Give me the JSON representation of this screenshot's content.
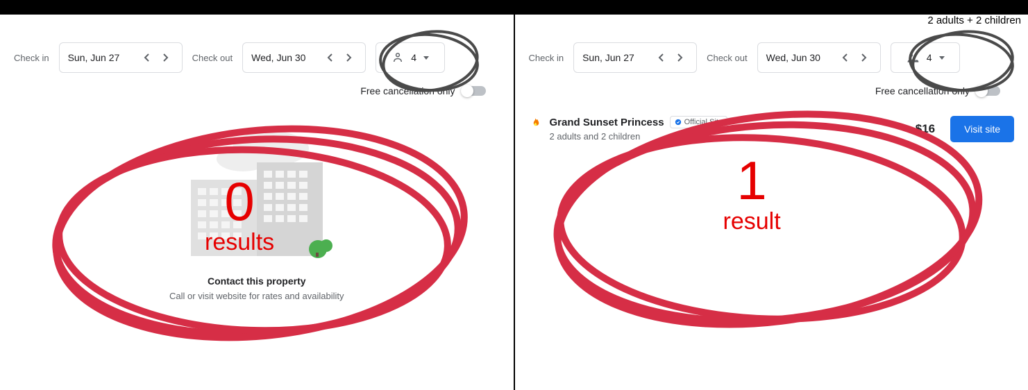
{
  "left": {
    "checkin_label": "Check in",
    "checkin_date": "Sun, Jun 27",
    "checkout_label": "Check out",
    "checkout_date": "Wed, Jun 30",
    "guest_count": "4",
    "free_cancel_label": "Free cancellation only",
    "empty_title": "Contact this property",
    "empty_sub": "Call or visit website for rates and availability",
    "annotation_big": "0",
    "annotation_small": "results"
  },
  "right": {
    "tooltip": "2 adults + 2 children",
    "checkin_label": "Check in",
    "checkin_date": "Sun, Jun 27",
    "checkout_label": "Check out",
    "checkout_date": "Wed, Jun 30",
    "guest_count": "4",
    "free_cancel_label": "Free cancellation only",
    "result_title": "Grand Sunset Princess",
    "result_badge": "Official Site",
    "result_sub": "2 adults and 2 children",
    "result_price": "$16",
    "visit_label": "Visit site",
    "annotation_big": "1",
    "annotation_small": "result"
  }
}
